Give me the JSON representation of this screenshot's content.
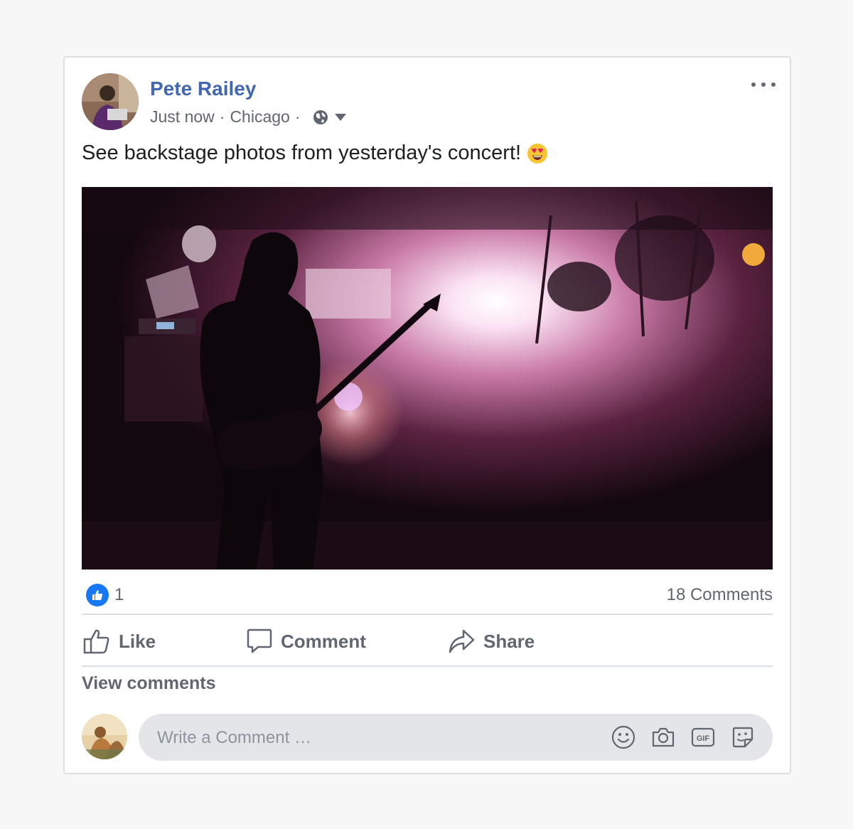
{
  "post": {
    "author": "Pete Railey",
    "timestamp": "Just now",
    "separator": "·",
    "location": "Chicago",
    "privacy_icon": "globe-icon",
    "text": "See backstage photos from yesterday's concert!",
    "emoji": "heart-eyes-emoji",
    "photo_subject": "guitarist silhouette on stage"
  },
  "stats": {
    "reaction_icon": "like-reaction-icon",
    "reaction_count": "1",
    "comments_count": "18 Comments"
  },
  "actions": {
    "like": "Like",
    "comment": "Comment",
    "share": "Share"
  },
  "comments": {
    "view_label": "View comments",
    "placeholder": "Write a Comment …",
    "icons": [
      "emoji-icon",
      "camera-icon",
      "gif-icon",
      "sticker-icon"
    ]
  },
  "colors": {
    "author_link": "#4267b2",
    "like_blue": "#1877f2",
    "muted_text": "#606770",
    "comment_box": "#e4e5e8"
  }
}
